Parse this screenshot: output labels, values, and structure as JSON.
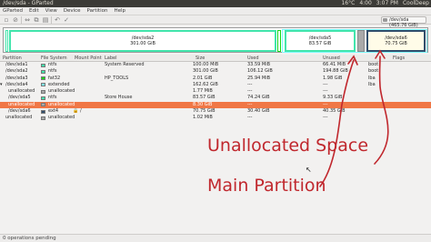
{
  "window": {
    "title": "/dev/sda - GParted",
    "tray": [
      "16°C",
      "4:00",
      "3:07 PM",
      "CoolDeep"
    ]
  },
  "menu": [
    "GParted",
    "Edit",
    "View",
    "Device",
    "Partition",
    "Help"
  ],
  "toolbar": {
    "device": "/dev/sda (465.76 GiB)"
  },
  "disk_map": [
    {
      "label": "",
      "size": ""
    },
    {
      "label": "/dev/sda2",
      "size": "301.00 GiB"
    },
    {
      "label": "/dev/sda5",
      "size": "83.57 GiB"
    },
    {
      "label": "/dev/sda6",
      "size": "70.75 GiB"
    }
  ],
  "table": {
    "headers": [
      "Partition",
      "File System",
      "Mount Point",
      "Label",
      "Size",
      "Used",
      "Unused",
      "Flags"
    ],
    "rows": [
      {
        "partition": "/dev/sda1",
        "fs": "ntfs",
        "mount": "",
        "label": "System Reserved",
        "size": "100.00 MiB",
        "used": "33.59 MiB",
        "unused": "66.41 MiB",
        "flags": "boot"
      },
      {
        "partition": "/dev/sda2",
        "fs": "ntfs",
        "mount": "",
        "label": "",
        "size": "301.00 GiB",
        "used": "106.12 GiB",
        "unused": "194.88 GiB",
        "flags": "boot"
      },
      {
        "partition": "/dev/sda3",
        "fs": "fat32",
        "mount": "",
        "label": "HP_TOOLS",
        "size": "2.01 GiB",
        "used": "25.94 MiB",
        "unused": "1.98 GiB",
        "flags": "lba"
      },
      {
        "partition": "/dev/sda4",
        "fs": "extended",
        "mount": "",
        "label": "",
        "size": "162.62 GiB",
        "used": "---",
        "unused": "---",
        "flags": "lba"
      },
      {
        "partition": "unallocated",
        "fs": "unallocated",
        "mount": "",
        "label": "",
        "size": "1.77 MiB",
        "used": "---",
        "unused": "---",
        "flags": ""
      },
      {
        "partition": "/dev/sda5",
        "fs": "ntfs",
        "mount": "",
        "label": "Store House",
        "size": "83.57 GiB",
        "used": "74.24 GiB",
        "unused": "9.33 GiB",
        "flags": ""
      },
      {
        "partition": "unallocated",
        "fs": "unallocated",
        "mount": "",
        "label": "",
        "size": "8.30 GiB",
        "used": "---",
        "unused": "---",
        "flags": ""
      },
      {
        "partition": "/dev/sda6",
        "fs": "ext4",
        "mount": "/",
        "label": "",
        "size": "70.75 GiB",
        "used": "30.40 GiB",
        "unused": "40.35 GiB",
        "flags": ""
      },
      {
        "partition": "unallocated",
        "fs": "unallocated",
        "mount": "",
        "label": "",
        "size": "1.02 MiB",
        "used": "---",
        "unused": "---",
        "flags": ""
      }
    ]
  },
  "status": "0 operations pending",
  "annotations": {
    "unallocated": "Unallocated Space",
    "main": "Main Partition"
  },
  "colors": {
    "annotation": "#c0272d",
    "selected_row": "#f07746",
    "ntfs": "#42e5ac",
    "fat32": "#18d818",
    "extended": "#7dfcfe",
    "unallocated": "#a9a9a9",
    "ext4": "#314e6c"
  }
}
